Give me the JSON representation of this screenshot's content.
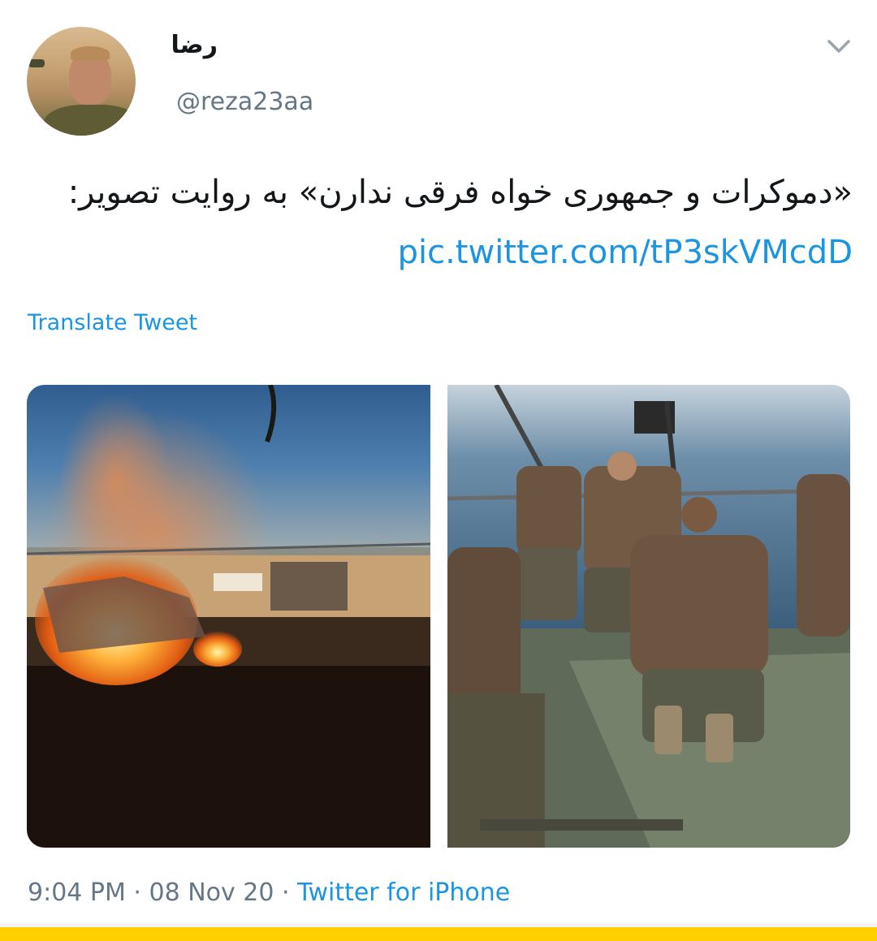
{
  "user": {
    "display_name": "رضا",
    "handle": "@reza23aa",
    "avatar_icon": "profile-photo"
  },
  "tweet": {
    "text": "«دموکرات و جمهوری خواه فرقی ندارن» به روایت تصویر: ",
    "link": "pic.twitter.com/tP3skVMcdD"
  },
  "actions": {
    "translate_label": "Translate Tweet",
    "menu_icon": "chevron-down-icon"
  },
  "media": [
    {
      "description_icon": "photo"
    },
    {
      "description_icon": "photo"
    }
  ],
  "meta": {
    "time": "9:04 PM",
    "date": "08 Nov 20",
    "source": "Twitter for iPhone",
    "separator": " · "
  },
  "colors": {
    "link": "#1b95e0",
    "secondary_text": "#657786",
    "bottom_bar": "#ffcf00"
  }
}
